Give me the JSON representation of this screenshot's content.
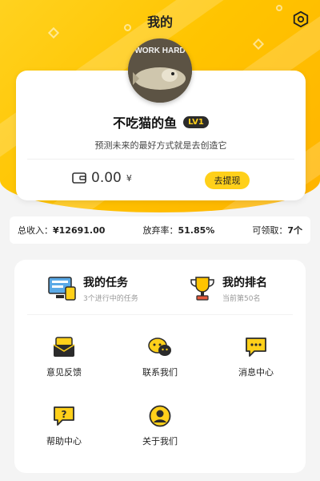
{
  "header": {
    "title": "我的",
    "settings_icon": "settings-hex-icon",
    "accent_color": "#ffc400"
  },
  "profile": {
    "avatar_text": "WORK HARD",
    "name": "不吃猫的鱼",
    "level": "LV1",
    "motto": "预测未来的最好方式就是去创造它",
    "balance_value": "0.00",
    "balance_unit": "¥",
    "withdraw_label": "去提现"
  },
  "stats": {
    "income_label": "总收入：",
    "income_value": "¥12691.00",
    "abandon_label": "放弃率：",
    "abandon_value": "51.85%",
    "claimable_label": "可领取：",
    "claimable_value": "7个"
  },
  "features": {
    "tasks": {
      "title": "我的任务",
      "subtitle": "3个进行中的任务"
    },
    "ranking": {
      "title": "我的排名",
      "subtitle": "当前第50名"
    }
  },
  "grid": {
    "feedback": "意见反馈",
    "contact": "联系我们",
    "messages": "消息中心",
    "help": "帮助中心",
    "about": "关于我们"
  }
}
